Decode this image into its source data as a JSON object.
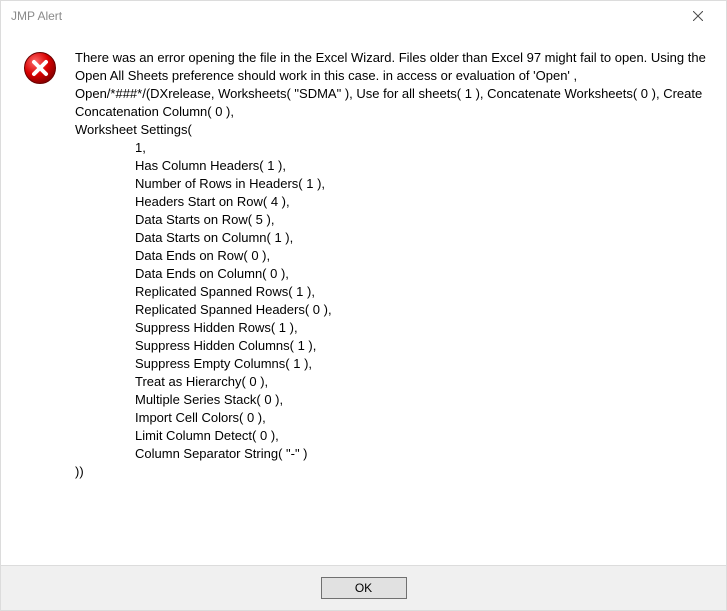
{
  "window": {
    "title": "JMP Alert"
  },
  "message": {
    "intro": "There was an error opening the file in the Excel Wizard. Files older than Excel 97 might fail to open. Using the Open All Sheets preference should work in this case. in access or evaluation of 'Open' , Open/*###*/(DXrelease, Worksheets( \"SDMA\" ), Use for all sheets( 1 ), Concatenate Worksheets( 0 ), Create Concatenation Column( 0 ),",
    "ws_header": "Worksheet Settings(",
    "settings": [
      "1,",
      "Has Column Headers( 1 ),",
      "Number of Rows in Headers( 1 ),",
      "Headers Start on Row( 4 ),",
      "Data Starts on Row( 5 ),",
      "Data Starts on Column( 1 ),",
      "Data Ends on Row( 0 ),",
      "Data Ends on Column( 0 ),",
      "Replicated Spanned Rows( 1 ),",
      "Replicated Spanned Headers( 0 ),",
      "Suppress Hidden Rows( 1 ),",
      "Suppress Hidden Columns( 1 ),",
      "Suppress Empty Columns( 1 ),",
      "Treat as Hierarchy( 0 ),",
      "Multiple Series Stack( 0 ),",
      "Import Cell Colors( 0 ),",
      "Limit Column Detect( 0 ),",
      "Column Separator String( \"-\" )"
    ],
    "closing": "))"
  },
  "buttons": {
    "ok": "OK"
  }
}
